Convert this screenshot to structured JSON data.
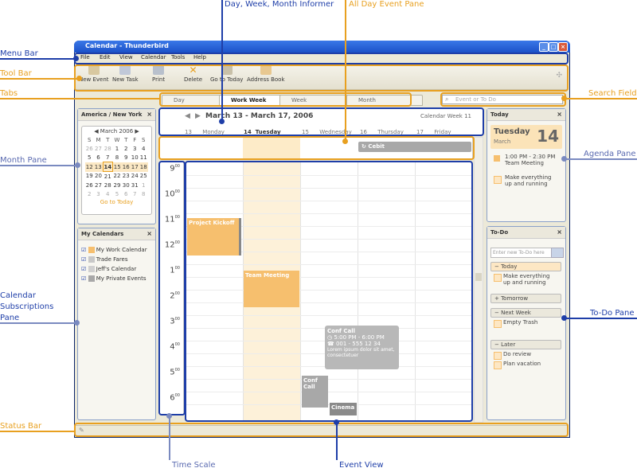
{
  "window": {
    "title": "Calendar - Thunderbird"
  },
  "menu": [
    "File",
    "Edit",
    "View",
    "Calendar",
    "Tools",
    "Help"
  ],
  "toolbar": [
    "New Event",
    "New Task",
    "Print",
    "Delete",
    "Go to Today",
    "Address Book"
  ],
  "tabs": [
    "Day",
    "Work Week",
    "Week",
    "Month"
  ],
  "search": {
    "placeholder": "Event or To Do"
  },
  "timezone": "America / New York",
  "minimonth": {
    "title": "March 2006",
    "weekdays": [
      "S",
      "M",
      "T",
      "W",
      "T",
      "F",
      "S"
    ],
    "weeks": [
      [
        "26",
        "27",
        "28",
        "1",
        "2",
        "3",
        "4"
      ],
      [
        "5",
        "6",
        "7",
        "8",
        "9",
        "10",
        "11"
      ],
      [
        "12",
        "13",
        "14",
        "15",
        "16",
        "17",
        "18"
      ],
      [
        "19",
        "20",
        "21",
        "22",
        "23",
        "24",
        "25"
      ],
      [
        "26",
        "27",
        "28",
        "29",
        "30",
        "31",
        "1"
      ],
      [
        "2",
        "3",
        "4",
        "5",
        "6",
        "7",
        "8"
      ]
    ],
    "goto_today": "Go to Today"
  },
  "my_calendars": {
    "title": "My Calendars",
    "items": [
      {
        "name": "My Work Calendar",
        "color": "#f6bf6e"
      },
      {
        "name": "Trade Fares",
        "color": "#c8c8c8"
      },
      {
        "name": "Jeff's Calendar",
        "color": "#d0d0d0"
      },
      {
        "name": "My Private Events",
        "color": "#a8a8a8"
      }
    ]
  },
  "informer": {
    "range": "March 13 - March 17, 2006",
    "week": "Calendar Week 11"
  },
  "days": [
    {
      "num": "13",
      "name": "Monday"
    },
    {
      "num": "14",
      "name": "Tuesday"
    },
    {
      "num": "15",
      "name": "Wednesday"
    },
    {
      "num": "16",
      "name": "Thursday"
    },
    {
      "num": "17",
      "name": "Friday"
    }
  ],
  "allday_event": "Cebit",
  "hours": [
    "9",
    "10",
    "11",
    "12",
    "1",
    "2",
    "3",
    "4",
    "5",
    "6"
  ],
  "hour_sup": "00",
  "events": {
    "kickoff": "Project Kickoff",
    "team": "Team Meeting",
    "conf": "Conf Call",
    "cinema": "Cinema",
    "popup_title": "Conf Call",
    "popup_time": "5:00 PM - 6:00 PM",
    "popup_phone": "001 - 555 12 34",
    "popup_text": "Lorem ipsum dolor sit amet, consectetuer"
  },
  "agenda": {
    "title": "Today",
    "day": "Tuesday",
    "month": "March",
    "date": "14",
    "item1_time": "1:00 PM - 2:30 PM",
    "item1_name": "Team Meeting",
    "item2_line1": "Make everything",
    "item2_line2": "up and running"
  },
  "todo": {
    "title": "To-Do",
    "placeholder": "Enter new To-Do here",
    "today": "Today",
    "today_line1": "Make everything",
    "today_line2": "up and running",
    "tomorrow": "Tomorrow",
    "nextweek": "Next Week",
    "nextweek_item": "Empty Trash",
    "later": "Later",
    "later_item1": "Do review",
    "later_item2": "Plan vacation"
  },
  "callouts": {
    "menu_bar": "Menu Bar",
    "tool_bar": "Tool Bar",
    "tabs": "Tabs",
    "month_pane": "Month Pane",
    "calendar_subscriptions": [
      "Calendar",
      "Subscriptions",
      "Pane"
    ],
    "status_bar": "Status Bar",
    "time_scale": "Time Scale",
    "event_view": "Event View",
    "informer": "Day,  Week, Month Informer",
    "all_day": "All Day Event Pane",
    "search_field": "Search Field",
    "agenda_pane": "Agenda Pane",
    "todo_pane": "To-Do Pane"
  },
  "colors": {
    "accent": "#1e3ea8",
    "highlight": "#e8a020",
    "event_orange": "#f6bf6e",
    "event_gray": "#a8a8a8"
  }
}
